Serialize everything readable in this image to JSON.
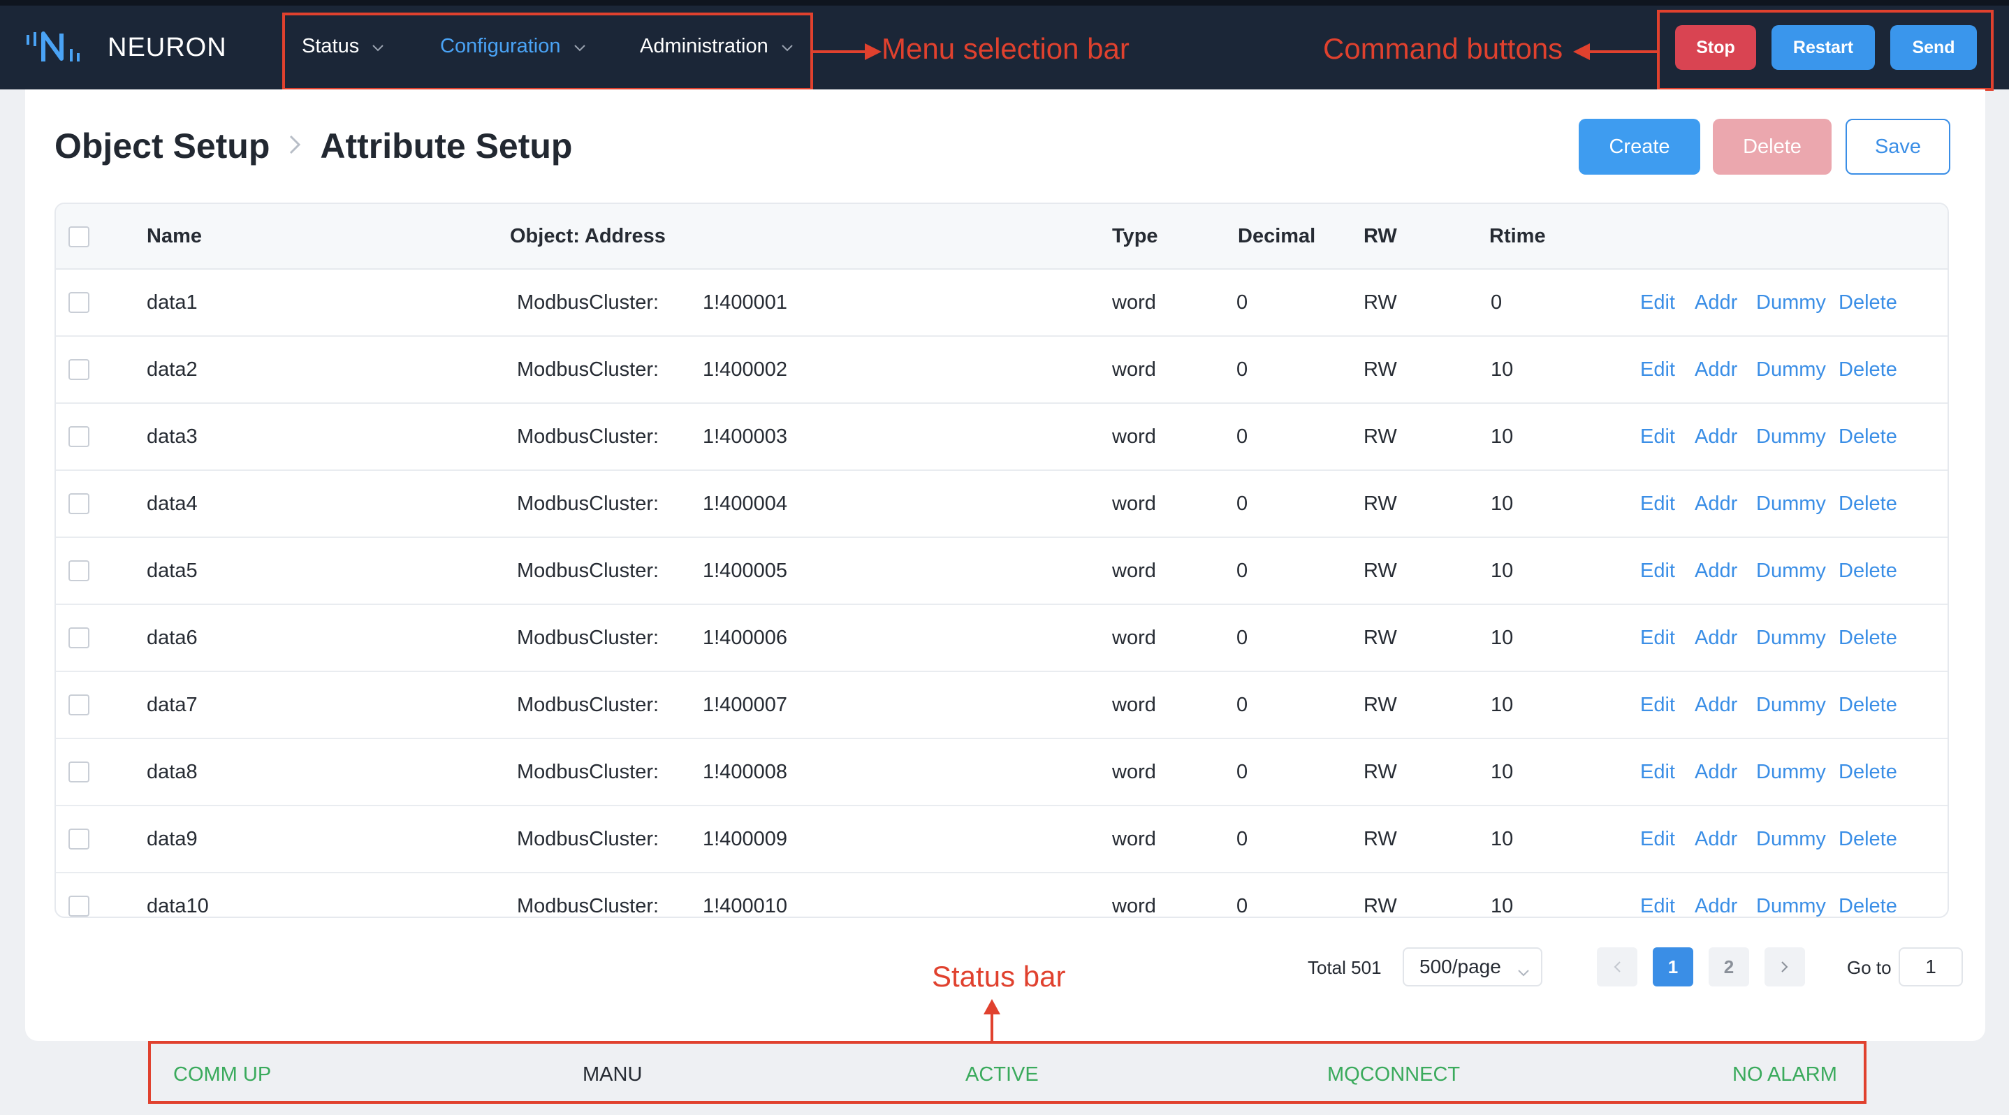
{
  "app": {
    "name": "NEURON"
  },
  "nav": [
    {
      "label": "Status",
      "active": false
    },
    {
      "label": "Configuration",
      "active": true
    },
    {
      "label": "Administration",
      "active": false
    }
  ],
  "commands": {
    "stop": "Stop",
    "restart": "Restart",
    "send": "Send"
  },
  "annotations": {
    "menu": "Menu selection bar",
    "commands": "Command buttons",
    "status": "Status bar"
  },
  "page": {
    "breadcrumb_parent": "Object Setup",
    "breadcrumb_current": "Attribute Setup",
    "create": "Create",
    "delete": "Delete",
    "save": "Save"
  },
  "table": {
    "headers": {
      "name": "Name",
      "address": "Object: Address",
      "type": "Type",
      "decimal": "Decimal",
      "rw": "RW",
      "rtime": "Rtime"
    },
    "actions": {
      "edit": "Edit",
      "addr": "Addr",
      "dummy": "Dummy",
      "delete": "Delete"
    },
    "rows": [
      {
        "name": "data1",
        "object": "ModbusCluster:",
        "address": "1!400001",
        "type": "word",
        "decimal": "0",
        "rw": "RW",
        "rtime": "0"
      },
      {
        "name": "data2",
        "object": "ModbusCluster:",
        "address": "1!400002",
        "type": "word",
        "decimal": "0",
        "rw": "RW",
        "rtime": "10"
      },
      {
        "name": "data3",
        "object": "ModbusCluster:",
        "address": "1!400003",
        "type": "word",
        "decimal": "0",
        "rw": "RW",
        "rtime": "10"
      },
      {
        "name": "data4",
        "object": "ModbusCluster:",
        "address": "1!400004",
        "type": "word",
        "decimal": "0",
        "rw": "RW",
        "rtime": "10"
      },
      {
        "name": "data5",
        "object": "ModbusCluster:",
        "address": "1!400005",
        "type": "word",
        "decimal": "0",
        "rw": "RW",
        "rtime": "10"
      },
      {
        "name": "data6",
        "object": "ModbusCluster:",
        "address": "1!400006",
        "type": "word",
        "decimal": "0",
        "rw": "RW",
        "rtime": "10"
      },
      {
        "name": "data7",
        "object": "ModbusCluster:",
        "address": "1!400007",
        "type": "word",
        "decimal": "0",
        "rw": "RW",
        "rtime": "10"
      },
      {
        "name": "data8",
        "object": "ModbusCluster:",
        "address": "1!400008",
        "type": "word",
        "decimal": "0",
        "rw": "RW",
        "rtime": "10"
      },
      {
        "name": "data9",
        "object": "ModbusCluster:",
        "address": "1!400009",
        "type": "word",
        "decimal": "0",
        "rw": "RW",
        "rtime": "10"
      },
      {
        "name": "data10",
        "object": "ModbusCluster:",
        "address": "1!400010",
        "type": "word",
        "decimal": "0",
        "rw": "RW",
        "rtime": "10"
      }
    ]
  },
  "pagination": {
    "total": "Total 501",
    "page_size": "500/page",
    "pages": [
      "1",
      "2"
    ],
    "current": "1",
    "goto_label": "Go to",
    "goto_value": "1"
  },
  "status_bar": [
    {
      "label": "COMM UP",
      "color": "#3aaa5c"
    },
    {
      "label": "MANU",
      "color": "#262b33"
    },
    {
      "label": "ACTIVE",
      "color": "#3aaa5c"
    },
    {
      "label": "MQCONNECT",
      "color": "#3aaa5c"
    },
    {
      "label": "NO ALARM",
      "color": "#3aaa5c"
    }
  ],
  "colors": {
    "accent": "#3a8ee6",
    "danger": "#d94452",
    "annotation": "#e0412e",
    "topbar": "#1b2637"
  }
}
